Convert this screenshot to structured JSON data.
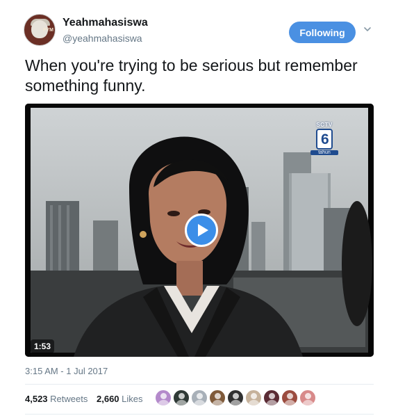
{
  "user": {
    "display_name": "Yeahmahasiswa",
    "handle": "@yeahmahasiswa",
    "avatar_tag": "FYM"
  },
  "follow_button": {
    "label": "Following"
  },
  "tweet": {
    "text": "When you're trying to be serious but remember something funny."
  },
  "video": {
    "duration": "1:53",
    "channel_logo_top": "SCTV",
    "channel_logo_bottom": "tahun"
  },
  "timestamp": "3:15 AM - 1 Jul 2017",
  "stats": {
    "retweets_count": "4,523",
    "retweets_label": "Retweets",
    "likes_count": "2,660",
    "likes_label": "Likes"
  },
  "likers": [
    {
      "color": "#b48acb"
    },
    {
      "color": "#2f3a36"
    },
    {
      "color": "#a8b0b8"
    },
    {
      "color": "#7f5a3a"
    },
    {
      "color": "#303030"
    },
    {
      "color": "#c6b29b"
    },
    {
      "color": "#5a2b34"
    },
    {
      "color": "#9b4c3f"
    },
    {
      "color": "#d88a8a"
    }
  ],
  "colors": {
    "follow_button": "#4a90e2",
    "secondary_text": "#657786",
    "play_button": "#3b8ee8"
  }
}
